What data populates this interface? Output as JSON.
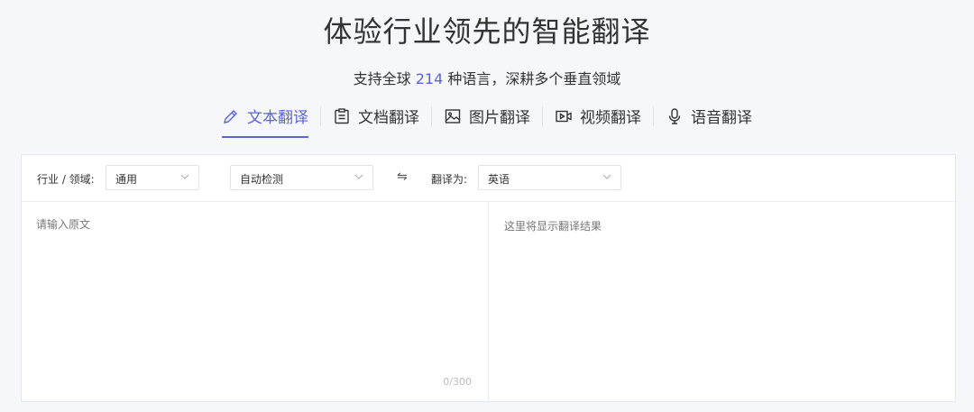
{
  "header": {
    "title": "体验行业领先的智能翻译",
    "subtitle_before": "支持全球",
    "language_count": "214",
    "subtitle_after": "种语言，深耕多个垂直领域"
  },
  "tabs": [
    {
      "label": "文本翻译",
      "icon": "pencil-icon",
      "active": true
    },
    {
      "label": "文档翻译",
      "icon": "document-icon",
      "active": false
    },
    {
      "label": "图片翻译",
      "icon": "image-icon",
      "active": false
    },
    {
      "label": "视频翻译",
      "icon": "video-icon",
      "active": false
    },
    {
      "label": "语音翻译",
      "icon": "microphone-icon",
      "active": false
    }
  ],
  "toolbar": {
    "domain_label": "行业 / 领域:",
    "domain_value": "通用",
    "source_lang": "自动检测",
    "swap_icon": "⇋",
    "target_label": "翻译为:",
    "target_lang": "英语"
  },
  "input": {
    "placeholder": "请输入原文",
    "counter": "0/300"
  },
  "output": {
    "placeholder": "这里将显示翻译结果"
  },
  "colors": {
    "accent": "#5b63d6",
    "background": "#f6f7fb",
    "border": "#e6e7ec"
  }
}
